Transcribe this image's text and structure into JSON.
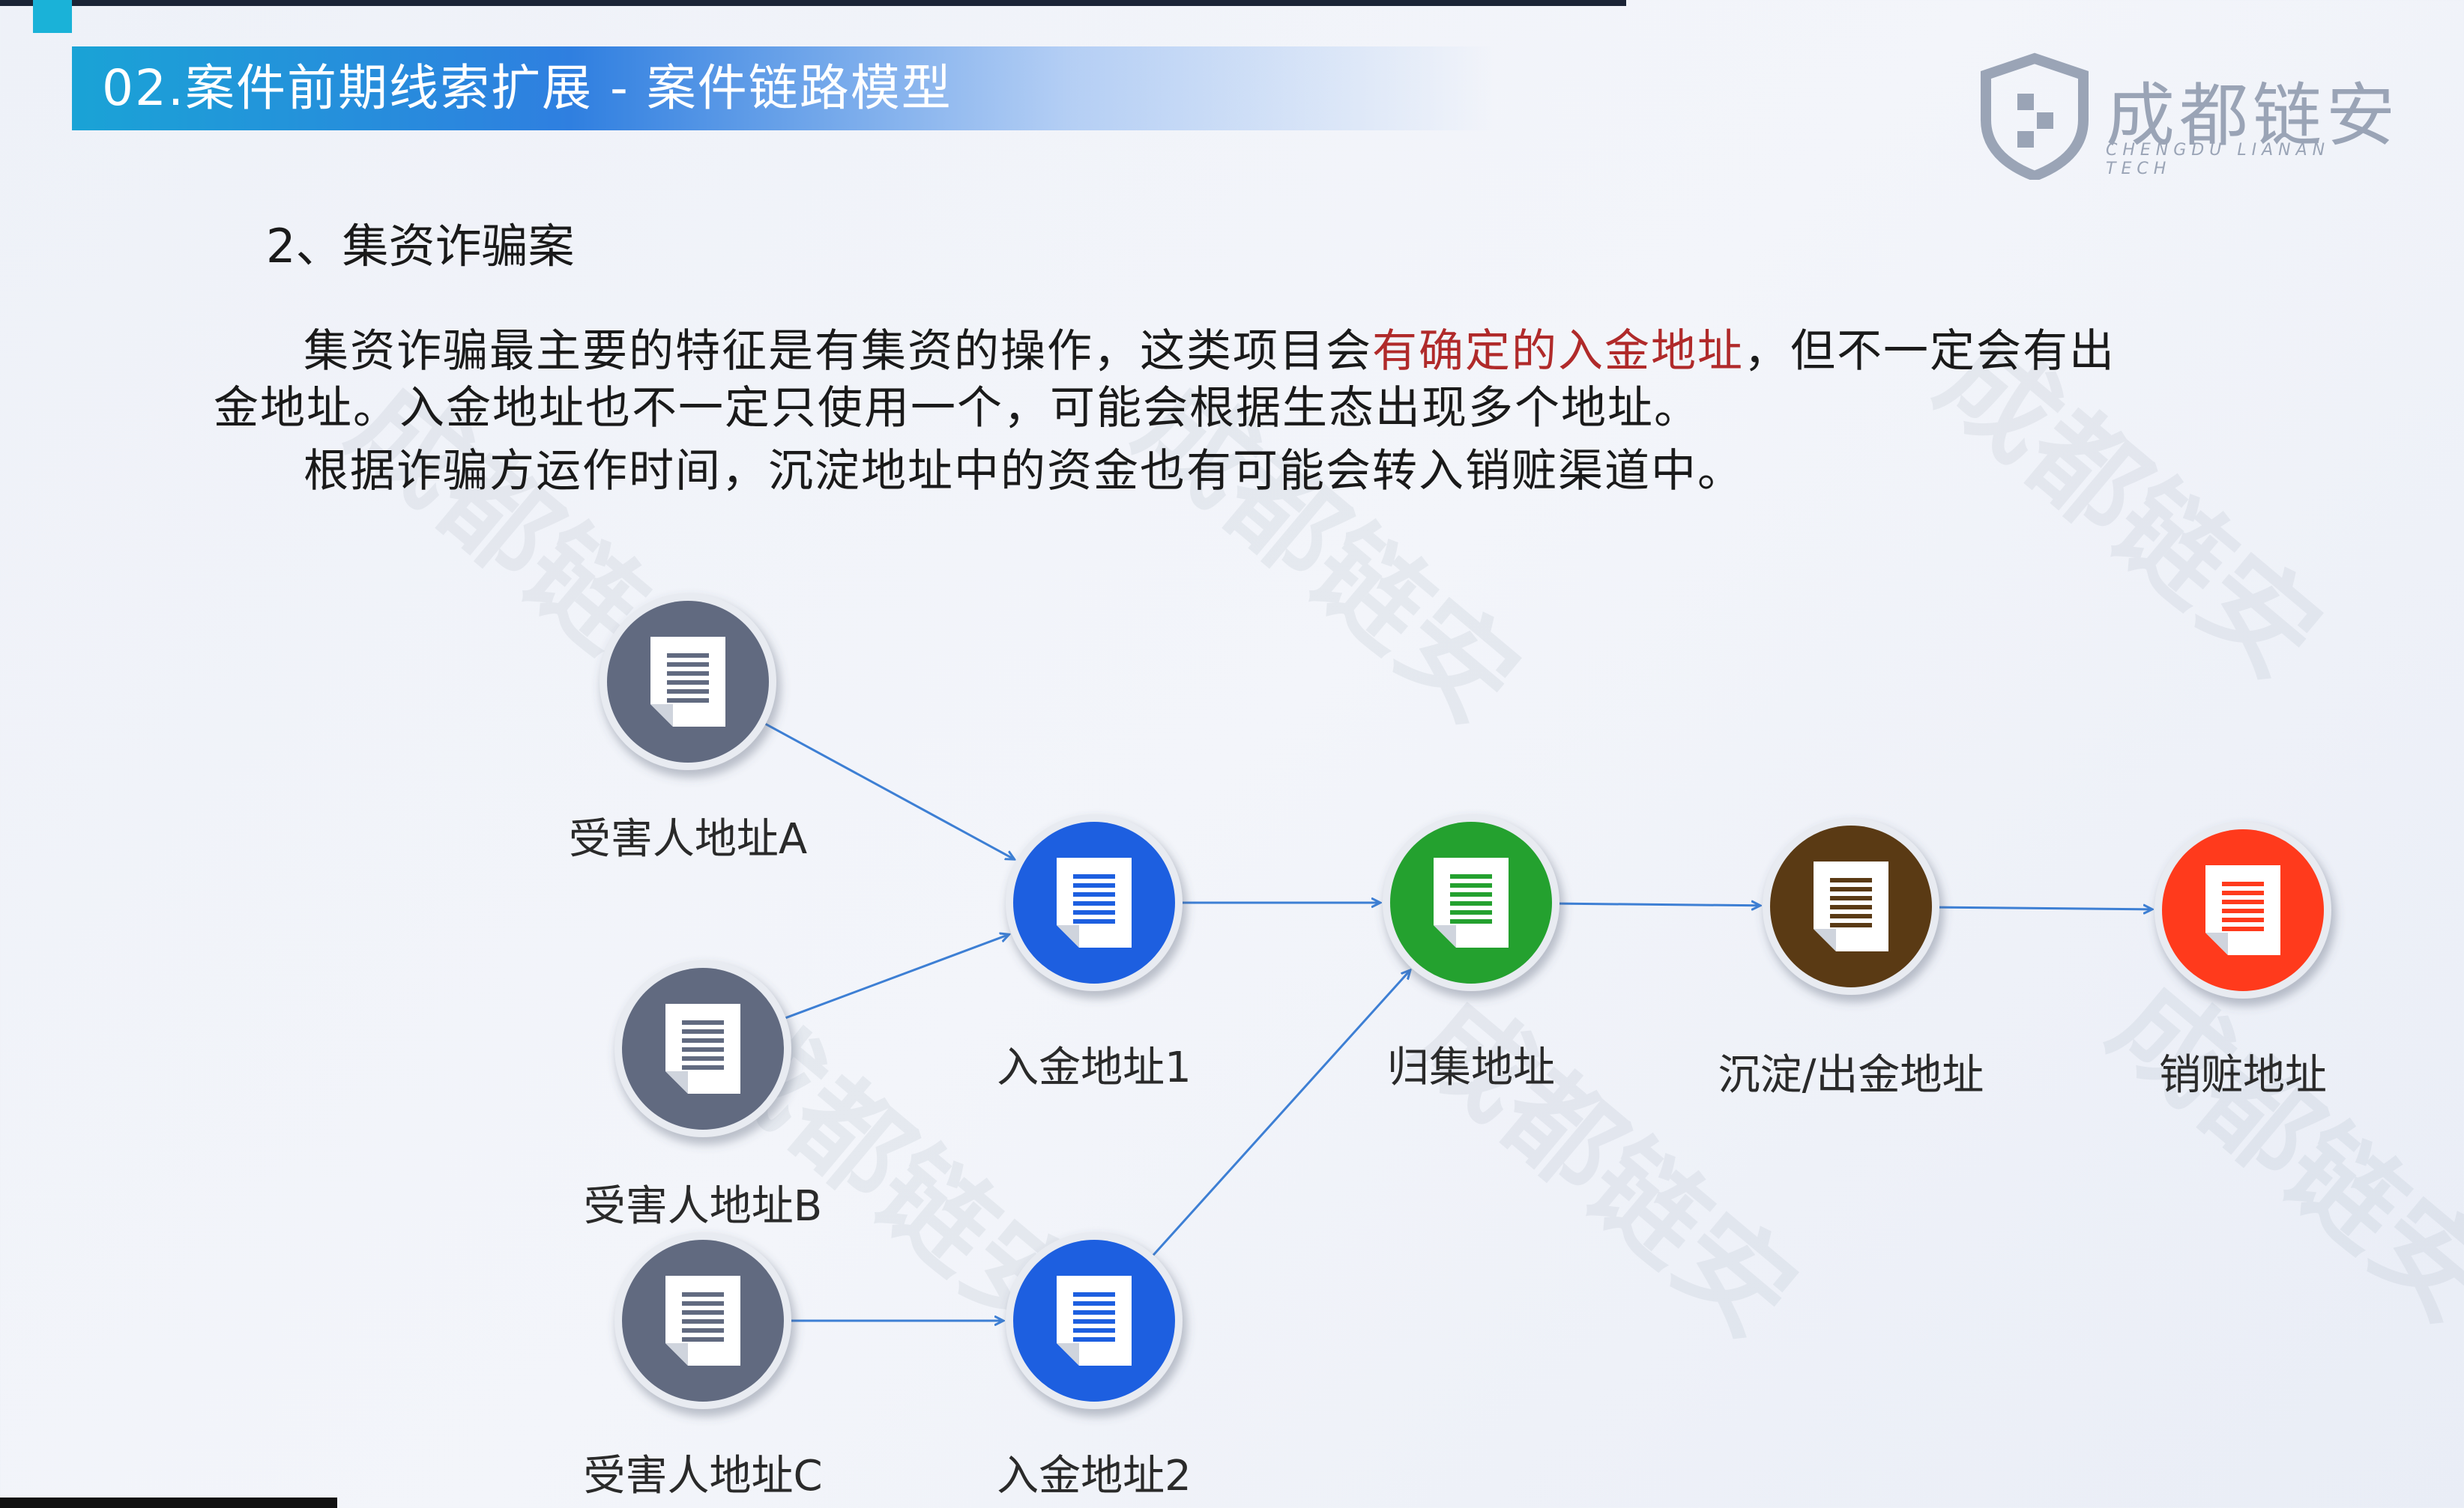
{
  "header": {
    "title": "02.案件前期线索扩展 - 案件链路模型"
  },
  "logo": {
    "name": "成都链安",
    "sub": "CHENGDU LIANAN TECH"
  },
  "section": {
    "title": "2、集资诈骗案",
    "para1_before": "集资诈骗最主要的特征是有集资的操作，这类项目会",
    "para1_highlight": "有确定的入金地址",
    "para1_after": "，但不一定会有出",
    "para2": "金地址。入金地址也不一定只使用一个，可能会根据生态出现多个地址。",
    "para3": "根据诈骗方运作时间，沉淀地址中的资金也有可能会转入销赃渠道中。"
  },
  "watermark": "成都链安",
  "nodes": [
    {
      "id": "victimA",
      "label": "受害人地址A",
      "color": "#616a80"
    },
    {
      "id": "victimB",
      "label": "受害人地址B",
      "color": "#616a80"
    },
    {
      "id": "victimC",
      "label": "受害人地址C",
      "color": "#616a80"
    },
    {
      "id": "deposit1",
      "label": "入金地址1",
      "color": "#1d5fe0"
    },
    {
      "id": "deposit2",
      "label": "入金地址2",
      "color": "#1d5fe0"
    },
    {
      "id": "collect",
      "label": "归集地址",
      "color": "#24a12f"
    },
    {
      "id": "settle",
      "label": "沉淀/出金地址",
      "color": "#5a3a14"
    },
    {
      "id": "launder",
      "label": "销赃地址",
      "color": "#ff3a1c"
    }
  ],
  "edges": [
    [
      "victimA",
      "deposit1"
    ],
    [
      "victimB",
      "deposit1"
    ],
    [
      "victimC",
      "deposit2"
    ],
    [
      "deposit1",
      "collect"
    ],
    [
      "deposit2",
      "collect"
    ],
    [
      "collect",
      "settle"
    ],
    [
      "settle",
      "launder"
    ]
  ],
  "colors": {
    "edge": "#3d7fd4",
    "doc_white": "#ffffff"
  }
}
